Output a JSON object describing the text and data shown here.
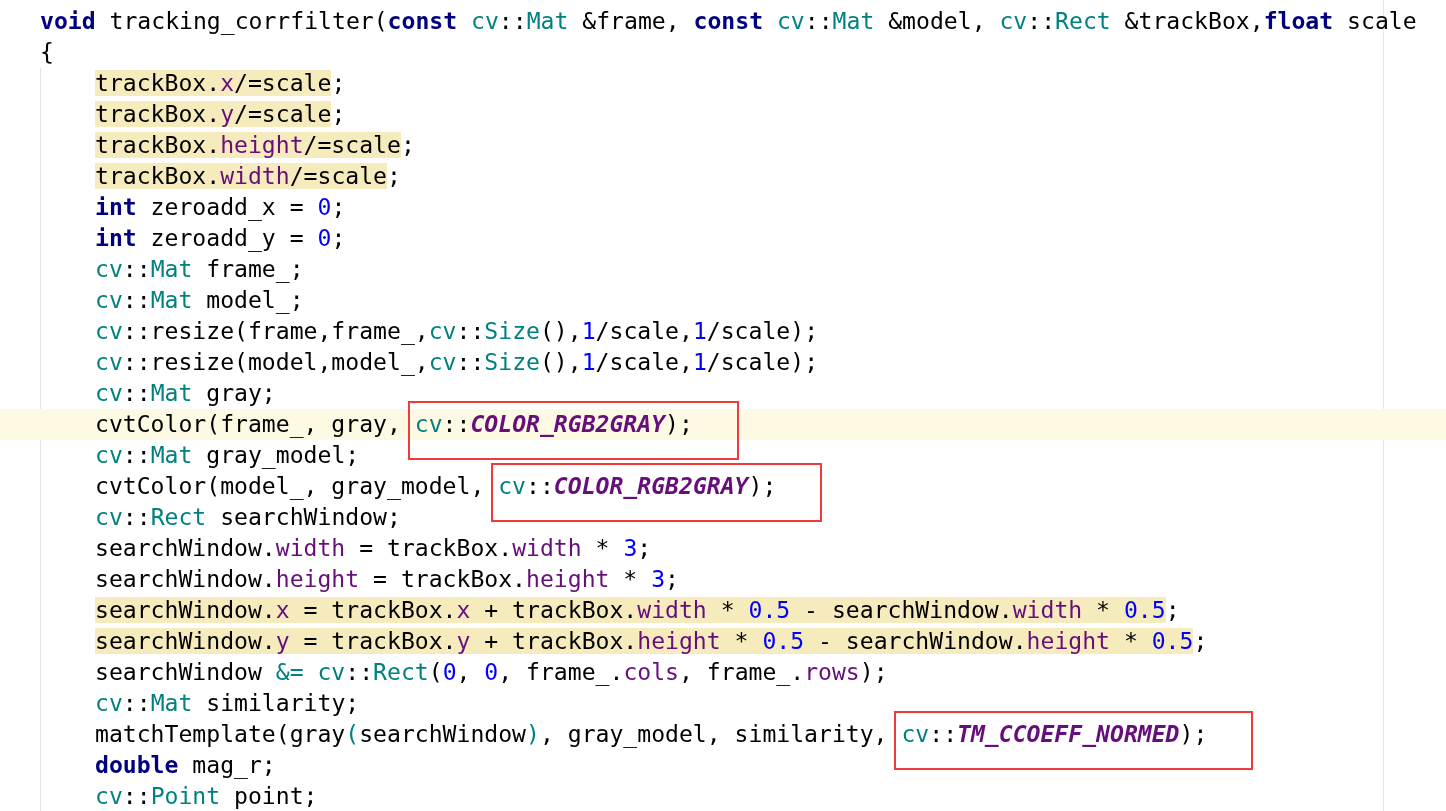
{
  "editor": {
    "signature": [
      {
        "t": "void",
        "kind": "kw"
      },
      {
        "t": " tracking_corrfilter("
      },
      {
        "t": "const",
        "kind": "kw"
      },
      {
        "t": " cv",
        "kind": "type"
      },
      {
        "t": "::"
      },
      {
        "t": "Mat",
        "kind": "type"
      },
      {
        "t": " &frame, "
      },
      {
        "t": "const",
        "kind": "kw"
      },
      {
        "t": " cv",
        "kind": "type"
      },
      {
        "t": "::"
      },
      {
        "t": "Mat",
        "kind": "type"
      },
      {
        "t": " &model, "
      },
      {
        "t": "cv",
        "kind": "type"
      },
      {
        "t": "::"
      },
      {
        "t": "Rect",
        "kind": "type"
      },
      {
        "t": " &trackBox,"
      },
      {
        "t": "float",
        "kind": "kw"
      },
      {
        "t": " scale"
      }
    ],
    "open_brace": "{",
    "body": [
      {
        "current": false,
        "tokens": [
          {
            "t": "trackBox.",
            "marked": true
          },
          {
            "t": "x",
            "kind": "member",
            "marked": true
          },
          {
            "t": "/=scale",
            "marked": true
          },
          {
            "t": ";"
          }
        ]
      },
      {
        "current": false,
        "tokens": [
          {
            "t": "trackBox.",
            "marked": true
          },
          {
            "t": "y",
            "kind": "member",
            "marked": true
          },
          {
            "t": "/=scale",
            "marked": true
          },
          {
            "t": ";"
          }
        ]
      },
      {
        "current": false,
        "tokens": [
          {
            "t": "trackBox.",
            "marked": true
          },
          {
            "t": "height",
            "kind": "member",
            "marked": true
          },
          {
            "t": "/=scale",
            "marked": true
          },
          {
            "t": ";"
          }
        ]
      },
      {
        "current": false,
        "tokens": [
          {
            "t": "trackBox.",
            "marked": true
          },
          {
            "t": "width",
            "kind": "member",
            "marked": true
          },
          {
            "t": "/=scale",
            "marked": true
          },
          {
            "t": ";"
          }
        ]
      },
      {
        "current": false,
        "tokens": [
          {
            "t": "int",
            "kind": "kw"
          },
          {
            "t": " zeroadd_x = "
          },
          {
            "t": "0",
            "kind": "num"
          },
          {
            "t": ";"
          }
        ]
      },
      {
        "current": false,
        "tokens": [
          {
            "t": "int",
            "kind": "kw"
          },
          {
            "t": " zeroadd_y = "
          },
          {
            "t": "0",
            "kind": "num"
          },
          {
            "t": ";"
          }
        ]
      },
      {
        "current": false,
        "tokens": [
          {
            "t": "cv",
            "kind": "type"
          },
          {
            "t": "::"
          },
          {
            "t": "Mat",
            "kind": "type"
          },
          {
            "t": " frame_;"
          }
        ]
      },
      {
        "current": false,
        "tokens": [
          {
            "t": "cv",
            "kind": "type"
          },
          {
            "t": "::"
          },
          {
            "t": "Mat",
            "kind": "type"
          },
          {
            "t": " model_;"
          }
        ]
      },
      {
        "current": false,
        "tokens": [
          {
            "t": "cv",
            "kind": "type"
          },
          {
            "t": "::resize(frame,frame_,"
          },
          {
            "t": "cv",
            "kind": "type"
          },
          {
            "t": "::"
          },
          {
            "t": "Size",
            "kind": "type"
          },
          {
            "t": "(),"
          },
          {
            "t": "1",
            "kind": "num"
          },
          {
            "t": "/scale,"
          },
          {
            "t": "1",
            "kind": "num"
          },
          {
            "t": "/scale);"
          }
        ]
      },
      {
        "current": false,
        "tokens": [
          {
            "t": "cv",
            "kind": "type"
          },
          {
            "t": "::resize(model,model_,"
          },
          {
            "t": "cv",
            "kind": "type"
          },
          {
            "t": "::"
          },
          {
            "t": "Size",
            "kind": "type"
          },
          {
            "t": "(),"
          },
          {
            "t": "1",
            "kind": "num"
          },
          {
            "t": "/scale,"
          },
          {
            "t": "1",
            "kind": "num"
          },
          {
            "t": "/scale);"
          }
        ]
      },
      {
        "current": false,
        "tokens": [
          {
            "t": "cv",
            "kind": "type"
          },
          {
            "t": "::"
          },
          {
            "t": "Mat",
            "kind": "type"
          },
          {
            "t": " gray;"
          }
        ]
      },
      {
        "current": true,
        "tokens": [
          {
            "t": "cvtColor(frame_, gray, "
          },
          {
            "kind": "box",
            "tokens": [
              {
                "t": "cv",
                "kind": "type"
              },
              {
                "t": "::"
              },
              {
                "t": "COLOR_RGB2GRAY",
                "kind": "const"
              },
              {
                "t": ");"
              }
            ]
          }
        ]
      },
      {
        "current": false,
        "tokens": [
          {
            "t": "cv",
            "kind": "type"
          },
          {
            "t": "::"
          },
          {
            "t": "Mat",
            "kind": "type"
          },
          {
            "t": " gray_model;"
          }
        ]
      },
      {
        "current": false,
        "tokens": [
          {
            "t": "cvtColor(model_, gray_model, "
          },
          {
            "kind": "box",
            "tokens": [
              {
                "t": "cv",
                "kind": "type"
              },
              {
                "t": "::"
              },
              {
                "t": "COLOR_RGB2GRAY",
                "kind": "const"
              },
              {
                "t": ");"
              }
            ]
          }
        ]
      },
      {
        "current": false,
        "tokens": [
          {
            "t": "cv",
            "kind": "type"
          },
          {
            "t": "::"
          },
          {
            "t": "Rect",
            "kind": "type"
          },
          {
            "t": " searchWindow;"
          }
        ]
      },
      {
        "current": false,
        "tokens": [
          {
            "t": "searchWindow."
          },
          {
            "t": "width",
            "kind": "member"
          },
          {
            "t": " = trackBox."
          },
          {
            "t": "width",
            "kind": "member"
          },
          {
            "t": " * "
          },
          {
            "t": "3",
            "kind": "num"
          },
          {
            "t": ";"
          }
        ]
      },
      {
        "current": false,
        "tokens": [
          {
            "t": "searchWindow."
          },
          {
            "t": "height",
            "kind": "member"
          },
          {
            "t": " = trackBox."
          },
          {
            "t": "height",
            "kind": "member"
          },
          {
            "t": " * "
          },
          {
            "t": "3",
            "kind": "num"
          },
          {
            "t": ";"
          }
        ]
      },
      {
        "current": false,
        "tokens": [
          {
            "t": "searchWindow.",
            "marked": true
          },
          {
            "t": "x",
            "kind": "member",
            "marked": true
          },
          {
            "t": " = trackBox.",
            "marked": true
          },
          {
            "t": "x",
            "kind": "member",
            "marked": true
          },
          {
            "t": " + trackBox.",
            "marked": true
          },
          {
            "t": "width",
            "kind": "member",
            "marked": true
          },
          {
            "t": " * ",
            "marked": true
          },
          {
            "t": "0.5",
            "kind": "num",
            "marked": true
          },
          {
            "t": " - searchWindow.",
            "marked": true
          },
          {
            "t": "width",
            "kind": "member",
            "marked": true
          },
          {
            "t": " * ",
            "marked": true
          },
          {
            "t": "0.5",
            "kind": "num",
            "marked": true
          },
          {
            "t": ";"
          }
        ]
      },
      {
        "current": false,
        "tokens": [
          {
            "t": "searchWindow.",
            "marked": true
          },
          {
            "t": "y",
            "kind": "member",
            "marked": true
          },
          {
            "t": " = trackBox.",
            "marked": true
          },
          {
            "t": "y",
            "kind": "member",
            "marked": true
          },
          {
            "t": " + trackBox.",
            "marked": true
          },
          {
            "t": "height",
            "kind": "member",
            "marked": true
          },
          {
            "t": " * ",
            "marked": true
          },
          {
            "t": "0.5",
            "kind": "num",
            "marked": true
          },
          {
            "t": " - searchWindow.",
            "marked": true
          },
          {
            "t": "height",
            "kind": "member",
            "marked": true
          },
          {
            "t": " * ",
            "marked": true
          },
          {
            "t": "0.5",
            "kind": "num",
            "marked": true
          },
          {
            "t": ";"
          }
        ]
      },
      {
        "current": false,
        "tokens": [
          {
            "t": "searchWindow "
          },
          {
            "t": "&=",
            "kind": "type"
          },
          {
            "t": " cv",
            "kind": "type"
          },
          {
            "t": "::"
          },
          {
            "t": "Rect",
            "kind": "type"
          },
          {
            "t": "("
          },
          {
            "t": "0",
            "kind": "num"
          },
          {
            "t": ", "
          },
          {
            "t": "0",
            "kind": "num"
          },
          {
            "t": ", frame_."
          },
          {
            "t": "cols",
            "kind": "member"
          },
          {
            "t": ", frame_."
          },
          {
            "t": "rows",
            "kind": "member"
          },
          {
            "t": ");"
          }
        ]
      },
      {
        "current": false,
        "tokens": [
          {
            "t": "cv",
            "kind": "type"
          },
          {
            "t": "::"
          },
          {
            "t": "Mat",
            "kind": "type"
          },
          {
            "t": " similarity;"
          }
        ]
      },
      {
        "current": false,
        "tokens": [
          {
            "t": "matchTemplate(gray"
          },
          {
            "t": "(",
            "kind": "type"
          },
          {
            "t": "searchWindow"
          },
          {
            "t": ")",
            "kind": "type"
          },
          {
            "t": ", gray_model, similarity, "
          },
          {
            "kind": "box",
            "tokens": [
              {
                "t": "cv",
                "kind": "type"
              },
              {
                "t": "::"
              },
              {
                "t": "TM_CCOEFF_NORMED",
                "kind": "const"
              },
              {
                "t": ");"
              }
            ]
          }
        ]
      },
      {
        "current": false,
        "tokens": [
          {
            "t": "double",
            "kind": "kw"
          },
          {
            "t": " mag_r;"
          }
        ]
      },
      {
        "current": false,
        "tokens": [
          {
            "t": "cv",
            "kind": "type"
          },
          {
            "t": "::"
          },
          {
            "t": "Point",
            "kind": "type"
          },
          {
            "t": " point;"
          }
        ]
      }
    ]
  }
}
